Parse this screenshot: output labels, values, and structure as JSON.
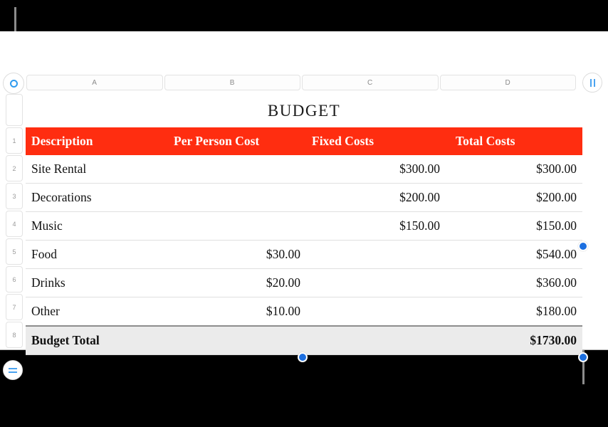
{
  "document": {
    "title": "BUDGET"
  },
  "column_headers": [
    "A",
    "B",
    "C",
    "D"
  ],
  "row_numbers": [
    "1",
    "2",
    "3",
    "4",
    "5",
    "6",
    "7",
    "8"
  ],
  "controls": {
    "corner_button": "table-select-ring-icon",
    "add_column_button": "add-column-icon",
    "add_row_button": "add-row-icon"
  },
  "colors": {
    "header_red": "#FF2D10",
    "header_text": "#FFFFFF",
    "total_row_background": "#EBEBEB",
    "handle_blue": "#1C6FE0",
    "control_blue": "#4AA3F0",
    "canvas": "#FFFFFF",
    "backdrop": "#000000"
  },
  "table": {
    "columns": [
      "Description",
      "Per Person Cost",
      "Fixed Costs",
      "Total Costs"
    ],
    "rows": [
      {
        "description": "Site Rental",
        "per_person": "",
        "fixed": "$300.00",
        "total": "$300.00"
      },
      {
        "description": "Decorations",
        "per_person": "",
        "fixed": "$200.00",
        "total": "$200.00"
      },
      {
        "description": "Music",
        "per_person": "",
        "fixed": "$150.00",
        "total": "$150.00"
      },
      {
        "description": "Food",
        "per_person": "$30.00",
        "fixed": "",
        "total": "$540.00"
      },
      {
        "description": "Drinks",
        "per_person": "$20.00",
        "fixed": "",
        "total": "$360.00"
      },
      {
        "description": "Other",
        "per_person": "$10.00",
        "fixed": "",
        "total": "$180.00"
      }
    ],
    "total_row": {
      "label": "Budget Total",
      "per_person": "",
      "fixed": "",
      "total": "$1730.00"
    }
  }
}
